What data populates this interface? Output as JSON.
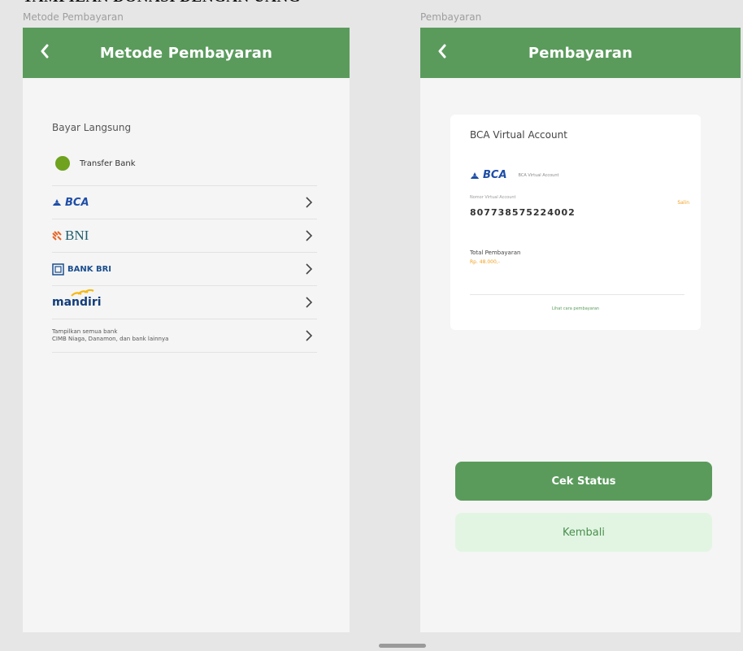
{
  "document": {
    "heading": "TAMPILAN DONASI DENGAN UANG"
  },
  "left_screen": {
    "frame_label": "Metode Pembayaran",
    "header_title": "Metode Pembayaran",
    "section_title": "Bayar Langsung",
    "method_label": "Transfer Bank",
    "banks": [
      {
        "label": "BCA"
      },
      {
        "label": "BNI"
      },
      {
        "label": "BANK BRI"
      },
      {
        "label": "mandiri"
      }
    ],
    "other_banks": {
      "line1": "Tampilkan semua bank",
      "line2": "CIMB Niaga, Danamon, dan bank lainnya"
    }
  },
  "right_screen": {
    "frame_label": "Pembayaran",
    "header_title": "Pembayaran",
    "card": {
      "title": "BCA Virtual Account",
      "bank_logo": "BCA",
      "bank_sub": "BCA Virtual Account",
      "va_label": "Nomor Virtual Account",
      "va_number": "807738575224002",
      "copy_label": "Salin",
      "total_label": "Total Pembayaran",
      "total_value": "Rp. 48.000,-",
      "howto_link": "Lihat cara pembayaran"
    },
    "primary_button": "Cek Status",
    "secondary_button": "Kembali"
  },
  "colors": {
    "primary_green": "#5a9b5c",
    "light_green": "#e2f5e3",
    "accent_orange": "#f0a020",
    "radio_green": "#6ea21f"
  },
  "icons": [
    "back-chevron-icon",
    "chevron-right-icon",
    "radio-selected-icon"
  ]
}
